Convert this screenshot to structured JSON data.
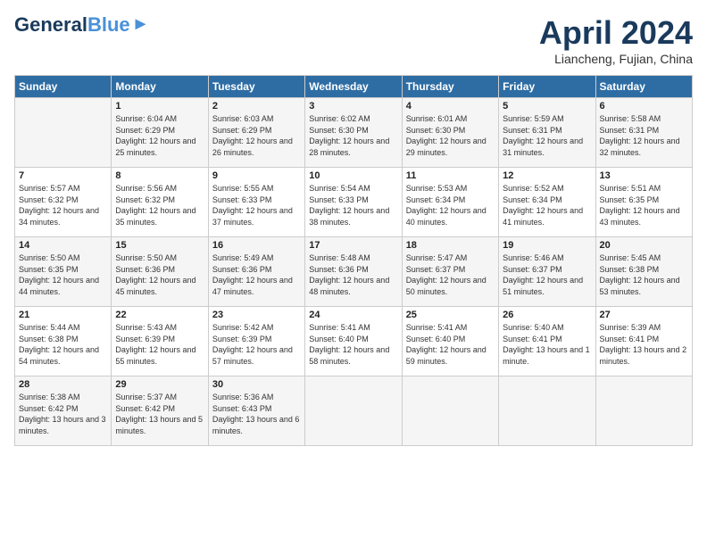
{
  "header": {
    "logo_general": "General",
    "logo_blue": "Blue",
    "month_title": "April 2024",
    "subtitle": "Liancheng, Fujian, China"
  },
  "weekdays": [
    "Sunday",
    "Monday",
    "Tuesday",
    "Wednesday",
    "Thursday",
    "Friday",
    "Saturday"
  ],
  "weeks": [
    [
      {
        "day": "",
        "sunrise": "",
        "sunset": "",
        "daylight": ""
      },
      {
        "day": "1",
        "sunrise": "Sunrise: 6:04 AM",
        "sunset": "Sunset: 6:29 PM",
        "daylight": "Daylight: 12 hours and 25 minutes."
      },
      {
        "day": "2",
        "sunrise": "Sunrise: 6:03 AM",
        "sunset": "Sunset: 6:29 PM",
        "daylight": "Daylight: 12 hours and 26 minutes."
      },
      {
        "day": "3",
        "sunrise": "Sunrise: 6:02 AM",
        "sunset": "Sunset: 6:30 PM",
        "daylight": "Daylight: 12 hours and 28 minutes."
      },
      {
        "day": "4",
        "sunrise": "Sunrise: 6:01 AM",
        "sunset": "Sunset: 6:30 PM",
        "daylight": "Daylight: 12 hours and 29 minutes."
      },
      {
        "day": "5",
        "sunrise": "Sunrise: 5:59 AM",
        "sunset": "Sunset: 6:31 PM",
        "daylight": "Daylight: 12 hours and 31 minutes."
      },
      {
        "day": "6",
        "sunrise": "Sunrise: 5:58 AM",
        "sunset": "Sunset: 6:31 PM",
        "daylight": "Daylight: 12 hours and 32 minutes."
      }
    ],
    [
      {
        "day": "7",
        "sunrise": "Sunrise: 5:57 AM",
        "sunset": "Sunset: 6:32 PM",
        "daylight": "Daylight: 12 hours and 34 minutes."
      },
      {
        "day": "8",
        "sunrise": "Sunrise: 5:56 AM",
        "sunset": "Sunset: 6:32 PM",
        "daylight": "Daylight: 12 hours and 35 minutes."
      },
      {
        "day": "9",
        "sunrise": "Sunrise: 5:55 AM",
        "sunset": "Sunset: 6:33 PM",
        "daylight": "Daylight: 12 hours and 37 minutes."
      },
      {
        "day": "10",
        "sunrise": "Sunrise: 5:54 AM",
        "sunset": "Sunset: 6:33 PM",
        "daylight": "Daylight: 12 hours and 38 minutes."
      },
      {
        "day": "11",
        "sunrise": "Sunrise: 5:53 AM",
        "sunset": "Sunset: 6:34 PM",
        "daylight": "Daylight: 12 hours and 40 minutes."
      },
      {
        "day": "12",
        "sunrise": "Sunrise: 5:52 AM",
        "sunset": "Sunset: 6:34 PM",
        "daylight": "Daylight: 12 hours and 41 minutes."
      },
      {
        "day": "13",
        "sunrise": "Sunrise: 5:51 AM",
        "sunset": "Sunset: 6:35 PM",
        "daylight": "Daylight: 12 hours and 43 minutes."
      }
    ],
    [
      {
        "day": "14",
        "sunrise": "Sunrise: 5:50 AM",
        "sunset": "Sunset: 6:35 PM",
        "daylight": "Daylight: 12 hours and 44 minutes."
      },
      {
        "day": "15",
        "sunrise": "Sunrise: 5:50 AM",
        "sunset": "Sunset: 6:36 PM",
        "daylight": "Daylight: 12 hours and 45 minutes."
      },
      {
        "day": "16",
        "sunrise": "Sunrise: 5:49 AM",
        "sunset": "Sunset: 6:36 PM",
        "daylight": "Daylight: 12 hours and 47 minutes."
      },
      {
        "day": "17",
        "sunrise": "Sunrise: 5:48 AM",
        "sunset": "Sunset: 6:36 PM",
        "daylight": "Daylight: 12 hours and 48 minutes."
      },
      {
        "day": "18",
        "sunrise": "Sunrise: 5:47 AM",
        "sunset": "Sunset: 6:37 PM",
        "daylight": "Daylight: 12 hours and 50 minutes."
      },
      {
        "day": "19",
        "sunrise": "Sunrise: 5:46 AM",
        "sunset": "Sunset: 6:37 PM",
        "daylight": "Daylight: 12 hours and 51 minutes."
      },
      {
        "day": "20",
        "sunrise": "Sunrise: 5:45 AM",
        "sunset": "Sunset: 6:38 PM",
        "daylight": "Daylight: 12 hours and 53 minutes."
      }
    ],
    [
      {
        "day": "21",
        "sunrise": "Sunrise: 5:44 AM",
        "sunset": "Sunset: 6:38 PM",
        "daylight": "Daylight: 12 hours and 54 minutes."
      },
      {
        "day": "22",
        "sunrise": "Sunrise: 5:43 AM",
        "sunset": "Sunset: 6:39 PM",
        "daylight": "Daylight: 12 hours and 55 minutes."
      },
      {
        "day": "23",
        "sunrise": "Sunrise: 5:42 AM",
        "sunset": "Sunset: 6:39 PM",
        "daylight": "Daylight: 12 hours and 57 minutes."
      },
      {
        "day": "24",
        "sunrise": "Sunrise: 5:41 AM",
        "sunset": "Sunset: 6:40 PM",
        "daylight": "Daylight: 12 hours and 58 minutes."
      },
      {
        "day": "25",
        "sunrise": "Sunrise: 5:41 AM",
        "sunset": "Sunset: 6:40 PM",
        "daylight": "Daylight: 12 hours and 59 minutes."
      },
      {
        "day": "26",
        "sunrise": "Sunrise: 5:40 AM",
        "sunset": "Sunset: 6:41 PM",
        "daylight": "Daylight: 13 hours and 1 minute."
      },
      {
        "day": "27",
        "sunrise": "Sunrise: 5:39 AM",
        "sunset": "Sunset: 6:41 PM",
        "daylight": "Daylight: 13 hours and 2 minutes."
      }
    ],
    [
      {
        "day": "28",
        "sunrise": "Sunrise: 5:38 AM",
        "sunset": "Sunset: 6:42 PM",
        "daylight": "Daylight: 13 hours and 3 minutes."
      },
      {
        "day": "29",
        "sunrise": "Sunrise: 5:37 AM",
        "sunset": "Sunset: 6:42 PM",
        "daylight": "Daylight: 13 hours and 5 minutes."
      },
      {
        "day": "30",
        "sunrise": "Sunrise: 5:36 AM",
        "sunset": "Sunset: 6:43 PM",
        "daylight": "Daylight: 13 hours and 6 minutes."
      },
      {
        "day": "",
        "sunrise": "",
        "sunset": "",
        "daylight": ""
      },
      {
        "day": "",
        "sunrise": "",
        "sunset": "",
        "daylight": ""
      },
      {
        "day": "",
        "sunrise": "",
        "sunset": "",
        "daylight": ""
      },
      {
        "day": "",
        "sunrise": "",
        "sunset": "",
        "daylight": ""
      }
    ]
  ]
}
